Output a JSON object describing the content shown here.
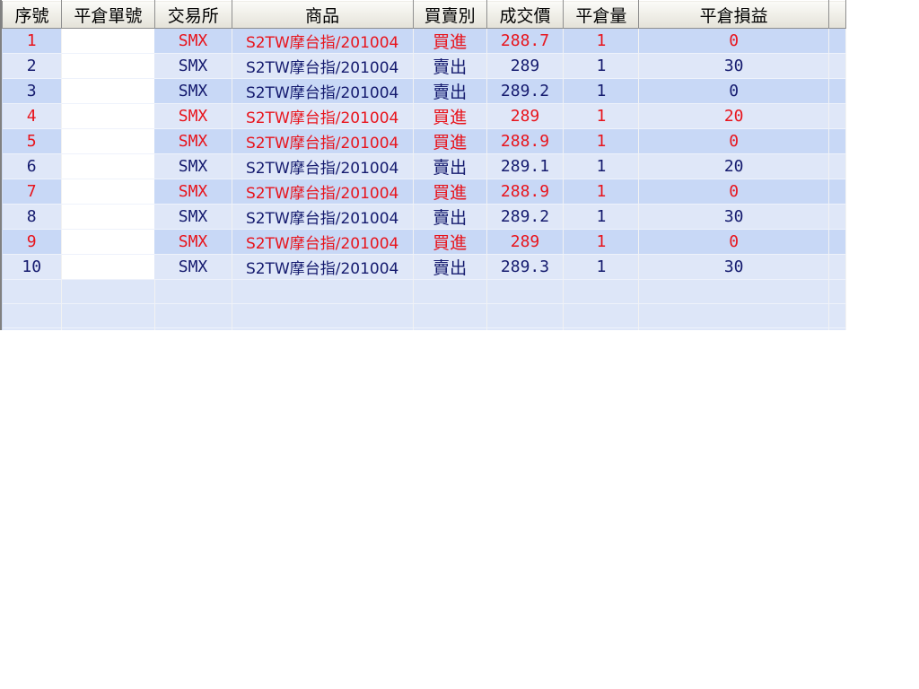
{
  "columns": [
    "序號",
    "平倉單號",
    "交易所",
    "商品",
    "買賣別",
    "成交價",
    "平倉量",
    "平倉損益"
  ],
  "rows": [
    {
      "seq": "1",
      "order": "",
      "exchange": "SMX",
      "product": "S2TW摩台指/201004",
      "side": "買進",
      "price": "288.7",
      "qty": "1",
      "pnl": "0",
      "color": "red"
    },
    {
      "seq": "2",
      "order": "",
      "exchange": "SMX",
      "product": "S2TW摩台指/201004",
      "side": "賣出",
      "price": "289",
      "qty": "1",
      "pnl": "30",
      "color": "blue"
    },
    {
      "seq": "3",
      "order": "",
      "exchange": "SMX",
      "product": "S2TW摩台指/201004",
      "side": "賣出",
      "price": "289.2",
      "qty": "1",
      "pnl": "0",
      "color": "blue"
    },
    {
      "seq": "4",
      "order": "",
      "exchange": "SMX",
      "product": "S2TW摩台指/201004",
      "side": "買進",
      "price": "289",
      "qty": "1",
      "pnl": "20",
      "color": "red"
    },
    {
      "seq": "5",
      "order": "",
      "exchange": "SMX",
      "product": "S2TW摩台指/201004",
      "side": "買進",
      "price": "288.9",
      "qty": "1",
      "pnl": "0",
      "color": "red"
    },
    {
      "seq": "6",
      "order": "",
      "exchange": "SMX",
      "product": "S2TW摩台指/201004",
      "side": "賣出",
      "price": "289.1",
      "qty": "1",
      "pnl": "20",
      "color": "blue"
    },
    {
      "seq": "7",
      "order": "",
      "exchange": "SMX",
      "product": "S2TW摩台指/201004",
      "side": "買進",
      "price": "288.9",
      "qty": "1",
      "pnl": "0",
      "color": "red"
    },
    {
      "seq": "8",
      "order": "",
      "exchange": "SMX",
      "product": "S2TW摩台指/201004",
      "side": "賣出",
      "price": "289.2",
      "qty": "1",
      "pnl": "30",
      "color": "blue"
    },
    {
      "seq": "9",
      "order": "",
      "exchange": "SMX",
      "product": "S2TW摩台指/201004",
      "side": "買進",
      "price": "289",
      "qty": "1",
      "pnl": "0",
      "color": "red"
    },
    {
      "seq": "10",
      "order": "",
      "exchange": "SMX",
      "product": "S2TW摩台指/201004",
      "side": "賣出",
      "price": "289.3",
      "qty": "1",
      "pnl": "30",
      "color": "blue"
    }
  ],
  "colors": {
    "buy": "#e8141c",
    "sell": "#141a6e",
    "grid_bg": "#cfdcf4"
  }
}
